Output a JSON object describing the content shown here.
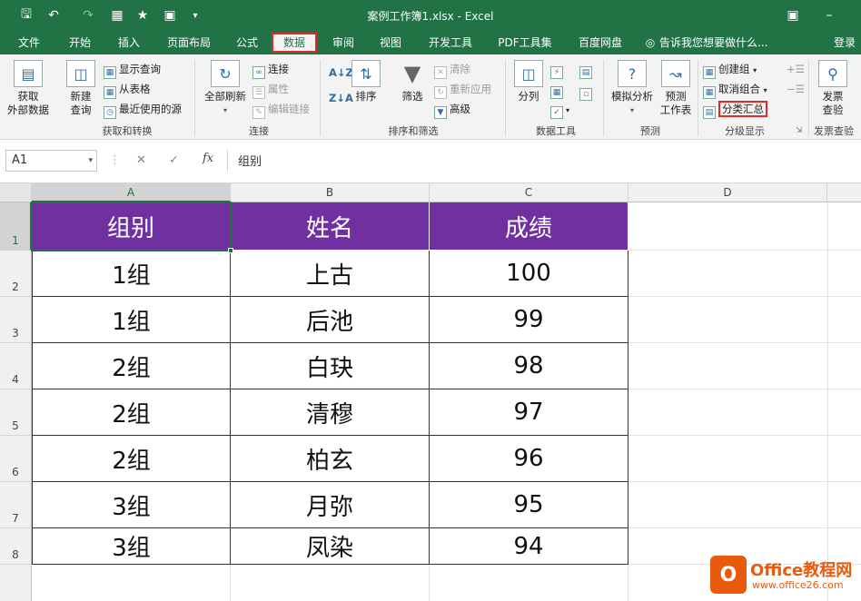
{
  "window": {
    "title": "案例工作簿1.xlsx - Excel",
    "qa_icons": [
      "save-icon",
      "undo-icon",
      "redo-icon",
      "form-icon",
      "star-icon",
      "camera-icon",
      "customize-icon"
    ]
  },
  "tabs": [
    {
      "label": "文件"
    },
    {
      "label": "开始"
    },
    {
      "label": "插入"
    },
    {
      "label": "页面布局"
    },
    {
      "label": "公式"
    },
    {
      "label": "数据",
      "active": true
    },
    {
      "label": "审阅"
    },
    {
      "label": "视图"
    },
    {
      "label": "开发工具"
    },
    {
      "label": "PDF工具集"
    },
    {
      "label": "百度网盘"
    }
  ],
  "tellme": "告诉我您想要做什么...",
  "login": "登录",
  "ribbon": {
    "get_transform": {
      "label": "获取和转换",
      "get_external": "获取\n外部数据",
      "new_query": "新建\n查询",
      "show_queries": "显示查询",
      "from_table": "从表格",
      "recent_sources": "最近使用的源"
    },
    "connections": {
      "label": "连接",
      "refresh_all": "全部刷新",
      "connections": "连接",
      "properties": "属性",
      "edit_links": "编辑链接"
    },
    "sort_filter": {
      "label": "排序和筛选",
      "sort": "排序",
      "filter": "筛选",
      "clear": "清除",
      "reapply": "重新应用",
      "advanced": "高级"
    },
    "data_tools": {
      "label": "数据工具",
      "text_to_columns": "分列"
    },
    "forecast": {
      "label": "预测",
      "what_if": "模拟分析",
      "forecast_sheet": "预测\n工作表"
    },
    "outline": {
      "label": "分级显示",
      "group": "创建组",
      "ungroup": "取消组合",
      "subtotal": "分类汇总"
    },
    "invoice": {
      "label": "发票查验",
      "check": "发票\n查验"
    }
  },
  "formula_bar": {
    "name_box": "A1",
    "fx": "fx",
    "formula": "组别"
  },
  "sheet": {
    "columns": [
      "A",
      "B",
      "C",
      "D"
    ],
    "rows": [
      "1",
      "2",
      "3",
      "4",
      "5",
      "6",
      "7",
      "8"
    ],
    "header_fill": "#7030a0",
    "table": [
      [
        "组别",
        "姓名",
        "成绩"
      ],
      [
        "1组",
        "上古",
        "100"
      ],
      [
        "1组",
        "后池",
        "99"
      ],
      [
        "2组",
        "白玦",
        "98"
      ],
      [
        "2组",
        "清穆",
        "97"
      ],
      [
        "2组",
        "柏玄",
        "96"
      ],
      [
        "3组",
        "月弥",
        "95"
      ],
      [
        "3组",
        "凤染",
        "94"
      ]
    ]
  },
  "watermark": {
    "brand": "Office教程网",
    "url": "www.office26.com",
    "color": "#e85a0c"
  }
}
